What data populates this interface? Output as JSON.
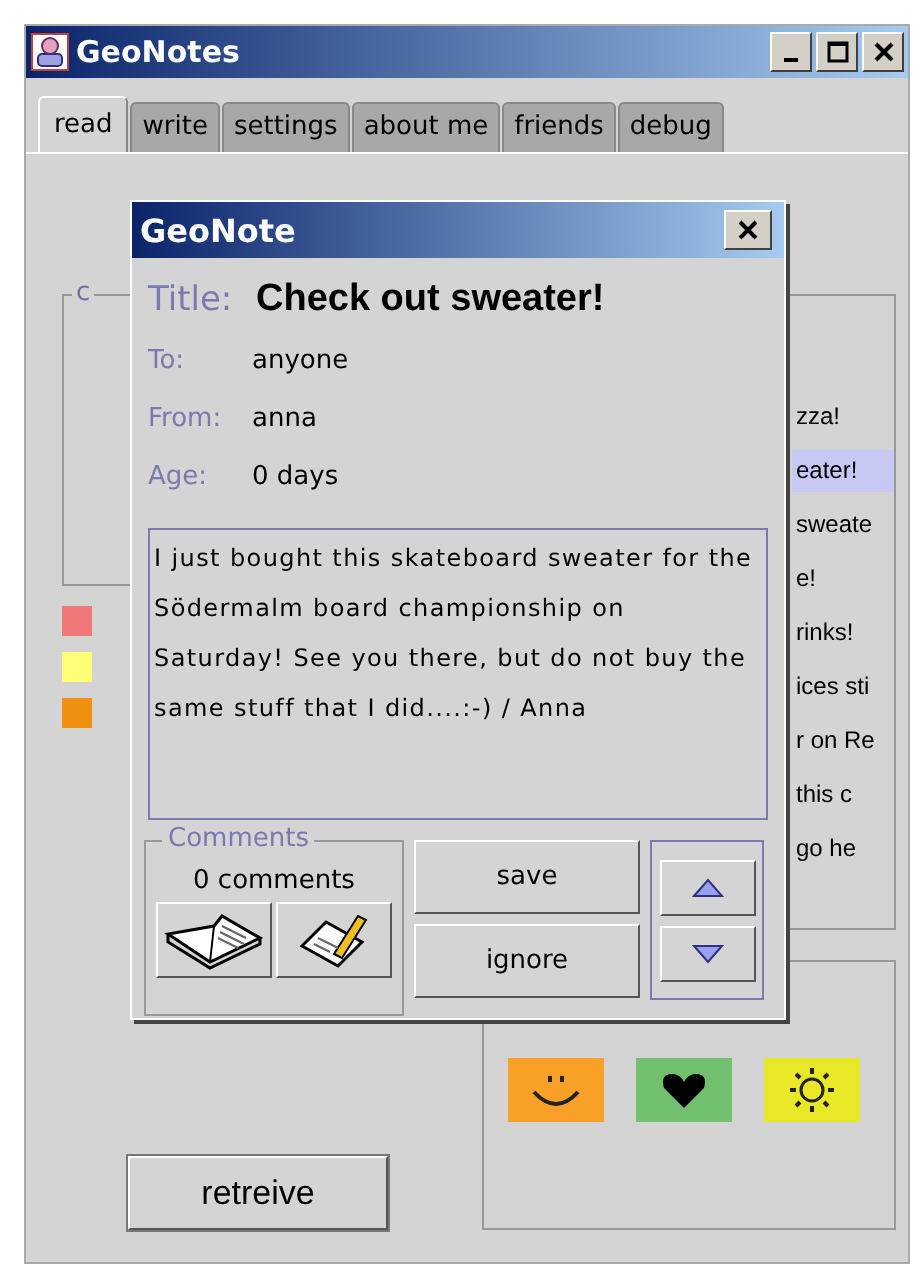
{
  "window": {
    "title": "GeoNotes"
  },
  "tabs": [
    {
      "label": "read",
      "selected": true
    },
    {
      "label": "write",
      "selected": false
    },
    {
      "label": "settings",
      "selected": false
    },
    {
      "label": "about me",
      "selected": false
    },
    {
      "label": "friends",
      "selected": false
    },
    {
      "label": "debug",
      "selected": false
    }
  ],
  "read_panel": {
    "group_label": "c",
    "color_markers": [
      {
        "color": "#f07878"
      },
      {
        "color": "#ffff78"
      },
      {
        "color": "#f09010"
      }
    ],
    "list_items": [
      {
        "text": "zza!",
        "selected": false
      },
      {
        "text": "eater!",
        "selected": true
      },
      {
        "text": "sweate",
        "selected": false
      },
      {
        "text": "e!",
        "selected": false
      },
      {
        "text": "rinks!",
        "selected": false
      },
      {
        "text": "ices sti",
        "selected": false
      },
      {
        "text": "r on Re",
        "selected": false
      },
      {
        "text": "this c",
        "selected": false
      },
      {
        "text": "go he",
        "selected": false
      }
    ],
    "moods": [
      {
        "kind": "smile",
        "color": "#f8a028"
      },
      {
        "kind": "heart",
        "color": "#70c070"
      },
      {
        "kind": "sun",
        "color": "#e8e828"
      }
    ],
    "retrieve_button": "retreive"
  },
  "dialog": {
    "title": "GeoNote",
    "fields": [
      {
        "kind": "title",
        "label": "Title:",
        "value": "Check out sweater!"
      },
      {
        "kind": "plain",
        "label": "To:",
        "value": "anyone"
      },
      {
        "kind": "plain",
        "label": "From:",
        "value": "anna"
      },
      {
        "kind": "plain",
        "label": "Age:",
        "value": "0 days"
      }
    ],
    "message": "I just bought this skateboard sweater for the Södermalm board championship on Saturday! See you there, but do not buy the same stuff that I did....:-) / Anna",
    "comments": {
      "label": "Comments",
      "count": "0 comments"
    },
    "buttons": [
      "save",
      "ignore"
    ]
  }
}
